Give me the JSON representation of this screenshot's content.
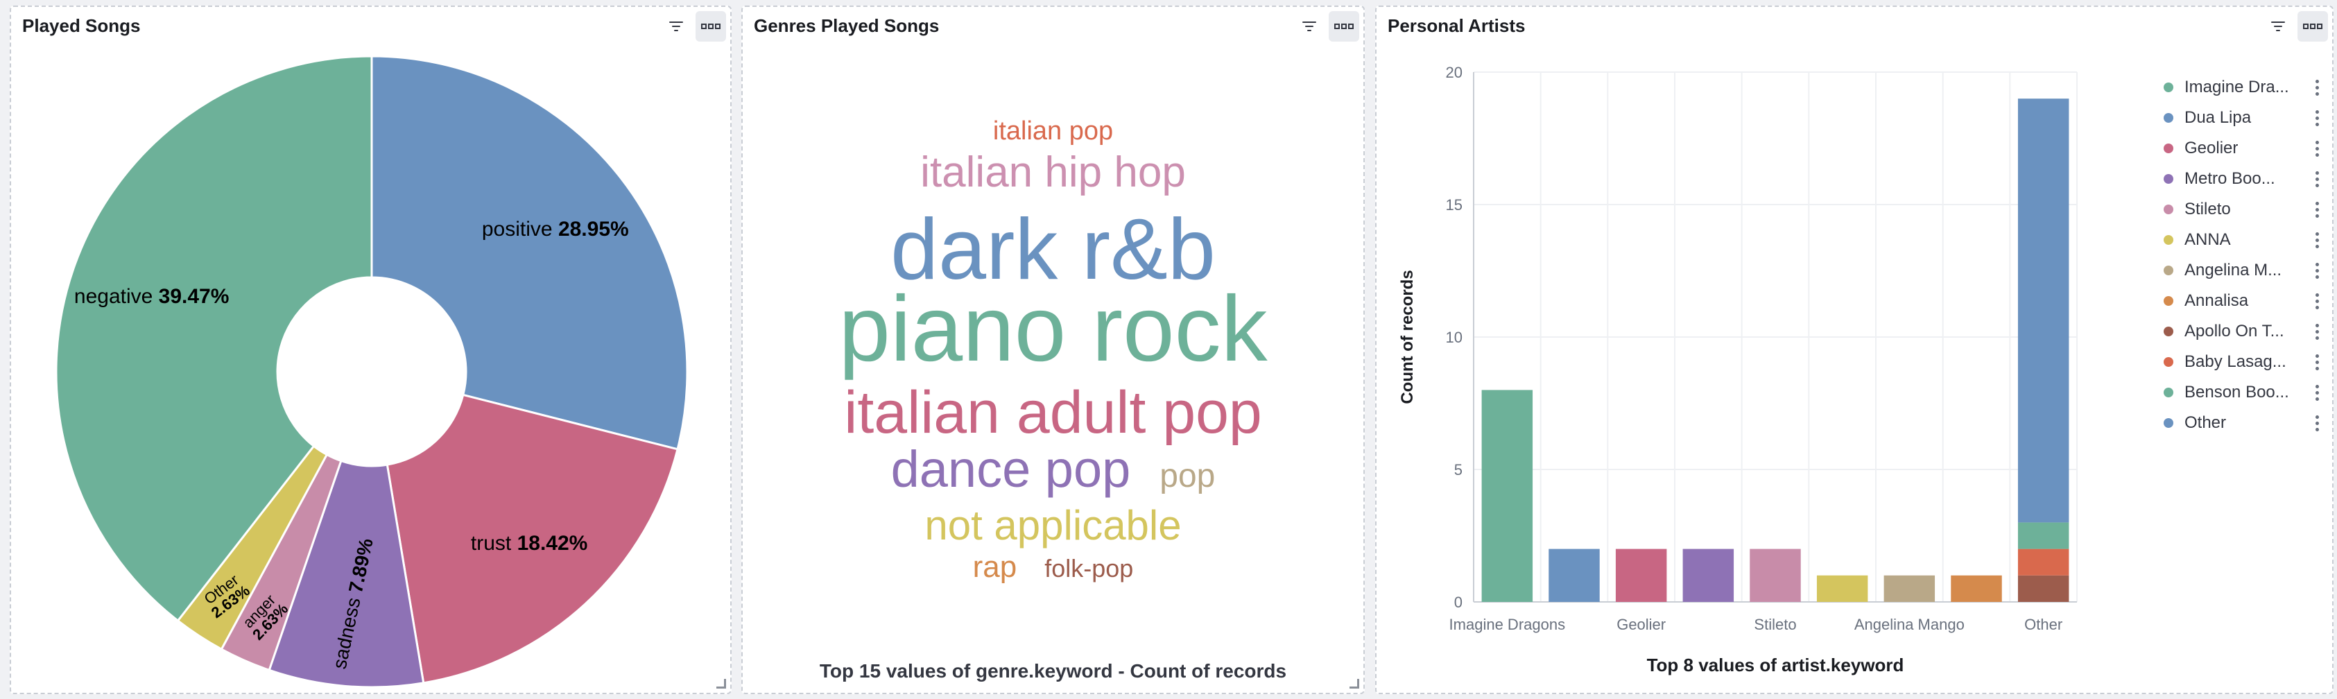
{
  "panels": {
    "songs": {
      "title": "Played Songs"
    },
    "genres": {
      "title": "Genres Played Songs",
      "caption": "Top 15 values of genre.keyword - Count of records"
    },
    "artists": {
      "title": "Personal Artists",
      "xlabel": "Top 8 values of artist.keyword",
      "ylabel": "Count of records"
    }
  },
  "chart_data": [
    {
      "type": "pie",
      "donut": true,
      "slices": [
        {
          "name": "positive",
          "label": "28.95%",
          "value": 28.95,
          "color": "#6a92c0"
        },
        {
          "name": "trust",
          "label": "18.42%",
          "value": 18.42,
          "color": "#c86683"
        },
        {
          "name": "sadness",
          "label": "7.89%",
          "value": 7.89,
          "color": "#8e72b5"
        },
        {
          "name": "anger",
          "label": "2.63%",
          "value": 2.63,
          "color": "#c88ca9"
        },
        {
          "name": "Other",
          "label": "2.63%",
          "value": 2.63,
          "color": "#d4c55e"
        },
        {
          "name": "negative",
          "label": "39.47%",
          "value": 39.47,
          "color": "#6db199"
        }
      ]
    },
    {
      "type": "wordcloud",
      "words": [
        {
          "text": "italian pop",
          "color": "#d9694d"
        },
        {
          "text": "italian hip hop",
          "color": "#cc90b0"
        },
        {
          "text": "dark r&b",
          "color": "#6a92c0"
        },
        {
          "text": "piano rock",
          "color": "#6db199"
        },
        {
          "text": "italian adult pop",
          "color": "#c86683"
        },
        {
          "text": "dance pop",
          "color": "#8e72b5"
        },
        {
          "text": "pop",
          "color": "#b9a888"
        },
        {
          "text": "not applicable",
          "color": "#d4c55e"
        },
        {
          "text": "rap",
          "color": "#d58a4c"
        },
        {
          "text": "folk-pop",
          "color": "#9c5c4c"
        }
      ]
    },
    {
      "type": "bar",
      "stacked": true,
      "categories": [
        "Imagine Dragons",
        "Dua Lipa",
        "Geolier",
        "Metro Boomin",
        "Stileto",
        "ANNA",
        "Angelina Mango",
        "Annalisa",
        "Other"
      ],
      "category_labels": [
        "Imagine Dragons",
        "",
        "Geolier",
        "",
        "Stileto",
        "",
        "Angelina Mango",
        "",
        "Other"
      ],
      "bar_values": [
        8,
        2,
        2,
        2,
        2,
        1,
        1,
        1,
        19
      ],
      "bar_colors": [
        "#6db199",
        "#6a92c0",
        "#c86683",
        "#8e72b5",
        "#c88ca9",
        "#d4c55e",
        "#b9a888",
        "#d58a4c"
      ],
      "other_stack": [
        {
          "name": "Apollo On T...",
          "value": 1,
          "color": "#9c5c4c"
        },
        {
          "name": "Baby Lasag...",
          "value": 1,
          "color": "#d9694d"
        },
        {
          "name": "Benson Boo...",
          "value": 1,
          "color": "#6db199"
        },
        {
          "name": "Other",
          "value": 16,
          "color": "#6a92c0"
        }
      ],
      "ylim": [
        0,
        20
      ],
      "yticks": [
        "0",
        "5",
        "10",
        "15",
        "20"
      ],
      "legend": [
        {
          "name": "Imagine Dra...",
          "color": "#6db199"
        },
        {
          "name": "Dua Lipa",
          "color": "#6a92c0"
        },
        {
          "name": "Geolier",
          "color": "#c86683"
        },
        {
          "name": "Metro Boo...",
          "color": "#8e72b5"
        },
        {
          "name": "Stileto",
          "color": "#c88ca9"
        },
        {
          "name": "ANNA",
          "color": "#d4c55e"
        },
        {
          "name": "Angelina M...",
          "color": "#b9a888"
        },
        {
          "name": "Annalisa",
          "color": "#d58a4c"
        },
        {
          "name": "Apollo On T...",
          "color": "#9c5c4c"
        },
        {
          "name": "Baby Lasag...",
          "color": "#d9694d"
        },
        {
          "name": "Benson Boo...",
          "color": "#6db199"
        },
        {
          "name": "Other",
          "color": "#6a92c0"
        }
      ]
    }
  ]
}
